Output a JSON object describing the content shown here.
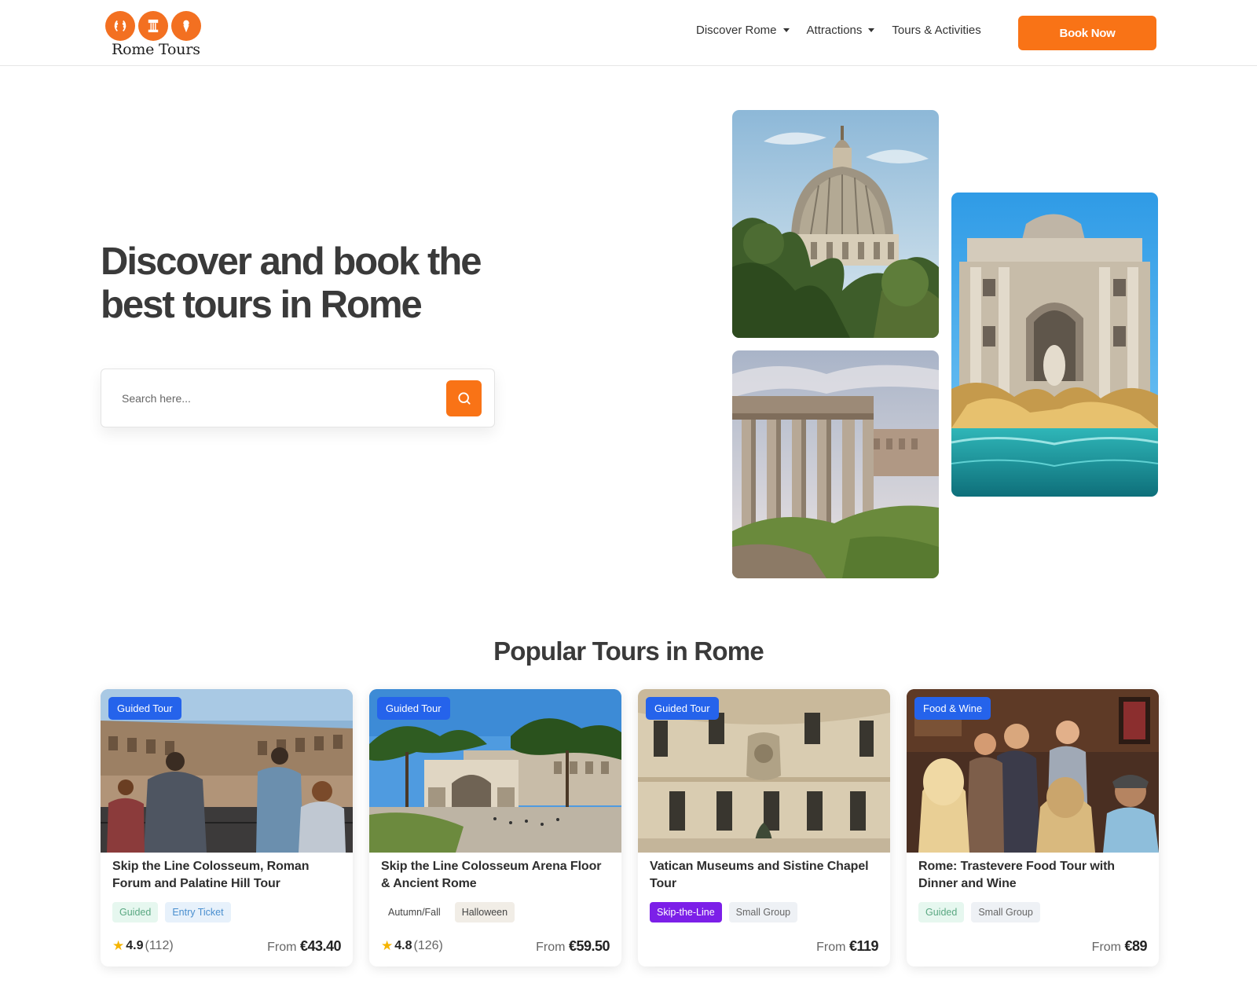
{
  "header": {
    "logo_text": "Rome Tours",
    "nav": [
      {
        "label": "Discover Rome",
        "dropdown": true
      },
      {
        "label": "Attractions",
        "dropdown": true
      },
      {
        "label": "Tours & Activities",
        "dropdown": false
      }
    ],
    "cta_label": "Book Now"
  },
  "hero": {
    "title": "Discover and book the best tours in Rome",
    "search_placeholder": "Search here..."
  },
  "popular": {
    "title": "Popular Tours in Rome",
    "cards": [
      {
        "badge": "Guided Tour",
        "title": "Skip the Line Colosseum, Roman Forum and Palatine Hill Tour",
        "tags": [
          "Guided",
          "Entry Ticket"
        ],
        "rating": "4.9",
        "reviews": "(112)",
        "price_prefix": "From",
        "price": "€43.40"
      },
      {
        "badge": "Guided Tour",
        "title": "Skip the Line Colosseum Arena Floor & Ancient Rome",
        "tags": [
          "Autumn/Fall",
          "Halloween"
        ],
        "rating": "4.8",
        "reviews": "(126)",
        "price_prefix": "From",
        "price": "€59.50"
      },
      {
        "badge": "Guided Tour",
        "title": "Vatican Museums and Sistine Chapel Tour",
        "tags": [
          "Skip-the-Line",
          "Small Group"
        ],
        "price_prefix": "From",
        "price": "€119"
      },
      {
        "badge": "Food & Wine",
        "title": "Rome: Trastevere Food Tour with Dinner and Wine",
        "tags": [
          "Guided",
          "Small Group"
        ],
        "price_prefix": "From",
        "price": "€89"
      }
    ]
  },
  "colors": {
    "accent": "#f97316",
    "badge_blue": "#2563eb",
    "skip_purple": "#7c1fe8"
  },
  "icons": [
    "laurel-icon",
    "column-icon",
    "gelato-icon",
    "search-icon",
    "caret-down-icon",
    "star-icon"
  ]
}
